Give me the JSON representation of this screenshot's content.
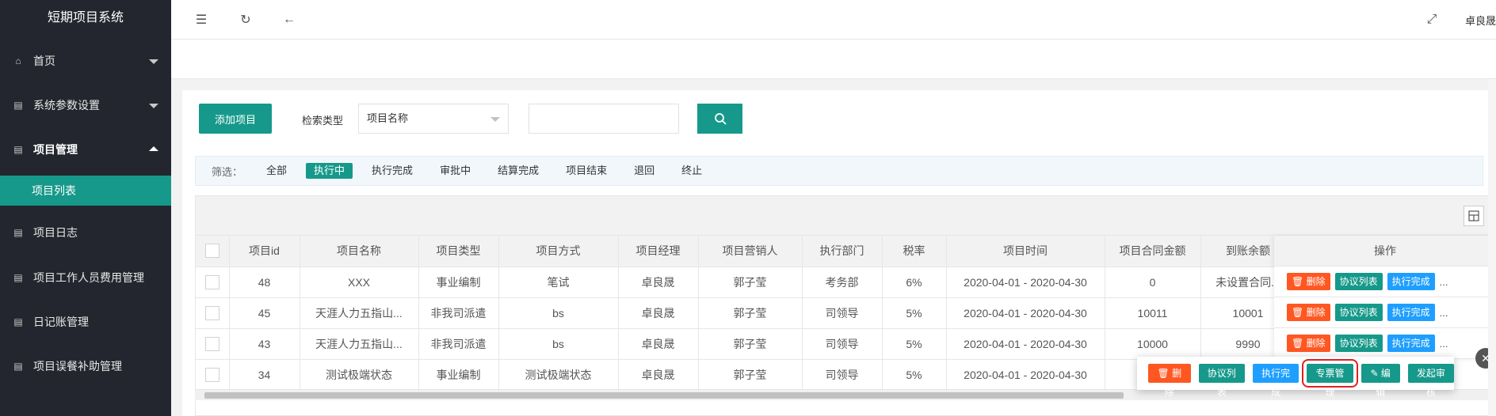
{
  "app": {
    "title": "短期项目系统"
  },
  "sidebar": {
    "items": [
      {
        "label": "首页",
        "icon": "home-icon"
      },
      {
        "label": "系统参数设置",
        "icon": "doc-icon"
      },
      {
        "label": "项目管理",
        "icon": "doc-icon"
      },
      {
        "label": "项目日志",
        "icon": "doc-icon"
      },
      {
        "label": "项目工作人员费用管理",
        "icon": "doc-icon"
      },
      {
        "label": "日记账管理",
        "icon": "doc-icon"
      },
      {
        "label": "项目误餐补助管理",
        "icon": "doc-icon"
      }
    ],
    "active_sub": "项目列表"
  },
  "topbar": {
    "user": "卓良晟"
  },
  "toolbar": {
    "add_label": "添加项目",
    "search_type_label": "检索类型",
    "search_type_value": "项目名称",
    "search_value": ""
  },
  "filters": {
    "label": "筛选：",
    "options": [
      "全部",
      "执行中",
      "执行完成",
      "审批中",
      "结算完成",
      "项目结束",
      "退回",
      "终止"
    ],
    "active": "执行中"
  },
  "table": {
    "columns": [
      "项目id",
      "项目名称",
      "项目类型",
      "项目方式",
      "项目经理",
      "项目营销人",
      "执行部门",
      "税率",
      "项目时间",
      "项目合同金额",
      "到账余额",
      "操作"
    ],
    "rows": [
      [
        "48",
        "XXX",
        "事业编制",
        "笔试",
        "卓良晟",
        "郭子莹",
        "考务部",
        "6%",
        "2020-04-01 - 2020-04-30",
        "0",
        "未设置合同..."
      ],
      [
        "45",
        "天涯人力五指山...",
        "非我司派遣",
        "bs",
        "卓良晟",
        "郭子莹",
        "司领导",
        "5%",
        "2020-04-01 - 2020-04-30",
        "10011",
        "10001"
      ],
      [
        "43",
        "天涯人力五指山...",
        "非我司派遣",
        "bs",
        "卓良晟",
        "郭子莹",
        "司领导",
        "5%",
        "2020-04-01 - 2020-04-30",
        "10000",
        "9990"
      ],
      [
        "34",
        "测试极端状态",
        "事业编制",
        "测试极端状态",
        "卓良晟",
        "郭子莹",
        "司领导",
        "5%",
        "2020-04-01 - 2020-04-30",
        "",
        ""
      ]
    ],
    "row_actions": {
      "delete": "删除",
      "agreement": "协议列表",
      "complete": "执行完成",
      "more": "..."
    }
  },
  "popup": {
    "delete": "删除",
    "agreement": "协议列表",
    "complete": "执行完成",
    "invoice": "专票管理",
    "edit": "编辑",
    "review": "发起审核"
  },
  "colors": {
    "accent": "#16998a",
    "danger": "#ff5722",
    "info": "#1e9fff",
    "sidebar": "#23262e"
  }
}
